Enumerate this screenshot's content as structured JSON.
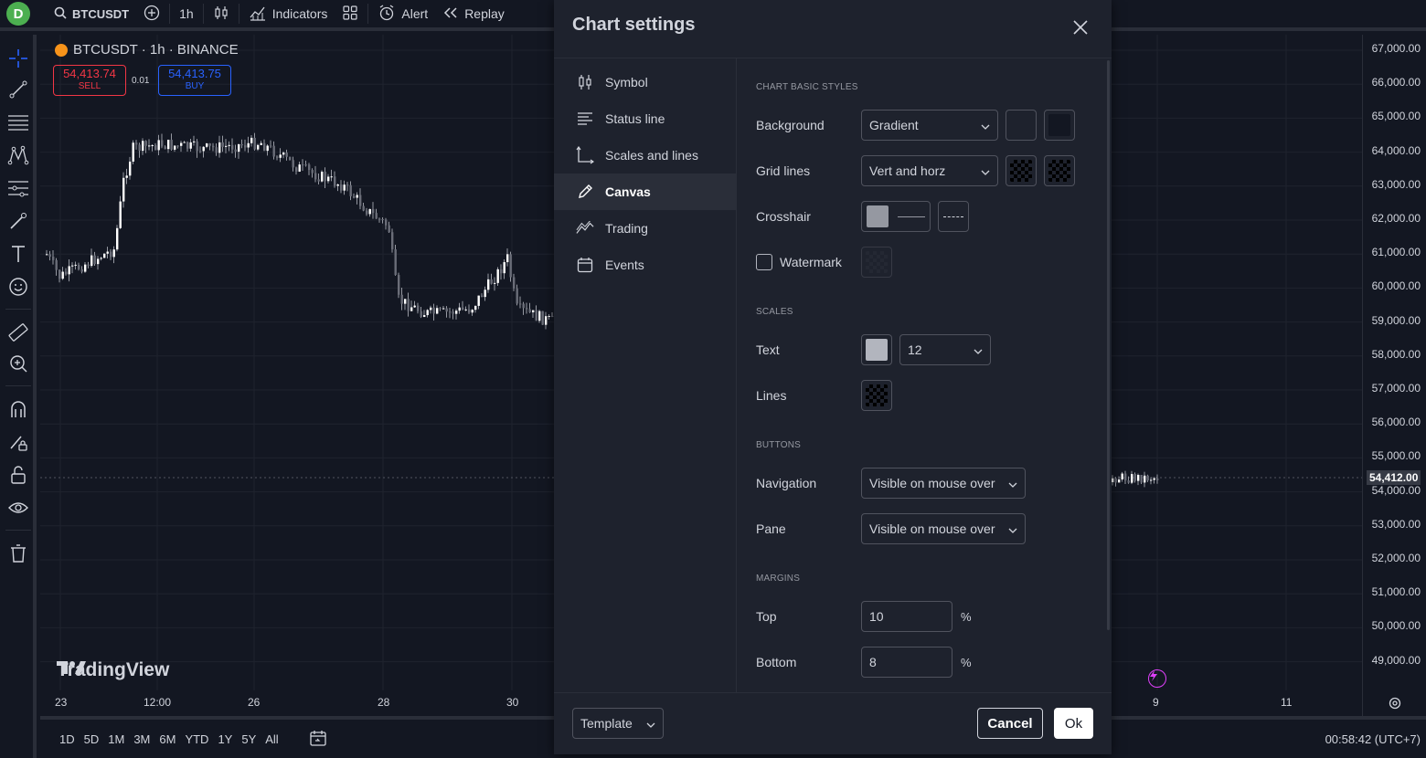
{
  "topbar": {
    "avatar_letter": "D",
    "symbol": "BTCUSDT",
    "interval": "1h",
    "indicators_label": "Indicators",
    "alert_label": "Alert",
    "replay_label": "Replay"
  },
  "legend": {
    "title": "BTCUSDT · 1h · BINANCE",
    "sell_price": "54,413.74",
    "sell_label": "SELL",
    "buy_price": "54,413.75",
    "buy_label": "BUY",
    "spread": "0.01"
  },
  "watermark": "TradingView",
  "price_axis": {
    "labels": [
      "67,000.00",
      "66,000.00",
      "65,000.00",
      "64,000.00",
      "63,000.00",
      "62,000.00",
      "61,000.00",
      "60,000.00",
      "59,000.00",
      "58,000.00",
      "57,000.00",
      "56,000.00",
      "55,000.00",
      "54,000.00",
      "53,000.00",
      "52,000.00",
      "51,000.00",
      "50,000.00",
      "49,000.00"
    ],
    "current": "54,412.00"
  },
  "time_axis": {
    "labels": [
      "23",
      "12:00",
      "26",
      "28",
      "30",
      "9",
      "11"
    ]
  },
  "bottombar": {
    "ranges": [
      "1D",
      "5D",
      "1M",
      "3M",
      "6M",
      "YTD",
      "1Y",
      "5Y",
      "All"
    ],
    "clock": "00:58:42 (UTC+7)"
  },
  "modal": {
    "title": "Chart settings",
    "nav": [
      {
        "label": "Symbol",
        "icon": "candles-icon"
      },
      {
        "label": "Status line",
        "icon": "status-line-icon"
      },
      {
        "label": "Scales and lines",
        "icon": "scales-icon"
      },
      {
        "label": "Canvas",
        "icon": "pencil-icon"
      },
      {
        "label": "Trading",
        "icon": "trading-icon"
      },
      {
        "label": "Events",
        "icon": "calendar-icon"
      }
    ],
    "active_nav": "Canvas",
    "sections": {
      "basic": "CHART BASIC STYLES",
      "scales": "SCALES",
      "buttons": "BUTTONS",
      "margins": "MARGINS"
    },
    "rows": {
      "background_label": "Background",
      "background_value": "Gradient",
      "grid_label": "Grid lines",
      "grid_value": "Vert and horz",
      "crosshair_label": "Crosshair",
      "watermark_label": "Watermark",
      "text_label": "Text",
      "text_size": "12",
      "lines_label": "Lines",
      "navigation_label": "Navigation",
      "navigation_value": "Visible on mouse over",
      "pane_label": "Pane",
      "pane_value": "Visible on mouse over",
      "top_label": "Top",
      "top_value": "10",
      "bottom_label": "Bottom",
      "bottom_value": "8",
      "pct": "%"
    },
    "footer": {
      "template_label": "Template",
      "cancel_label": "Cancel",
      "ok_label": "Ok"
    }
  },
  "colors": {
    "bg": "#131722",
    "panel": "#1e222d",
    "sell": "#f23645",
    "buy": "#2962ff",
    "avatar": "#4caf50",
    "crosshair_swatch": "#9598a1",
    "text_swatch": "#b2b5be"
  }
}
